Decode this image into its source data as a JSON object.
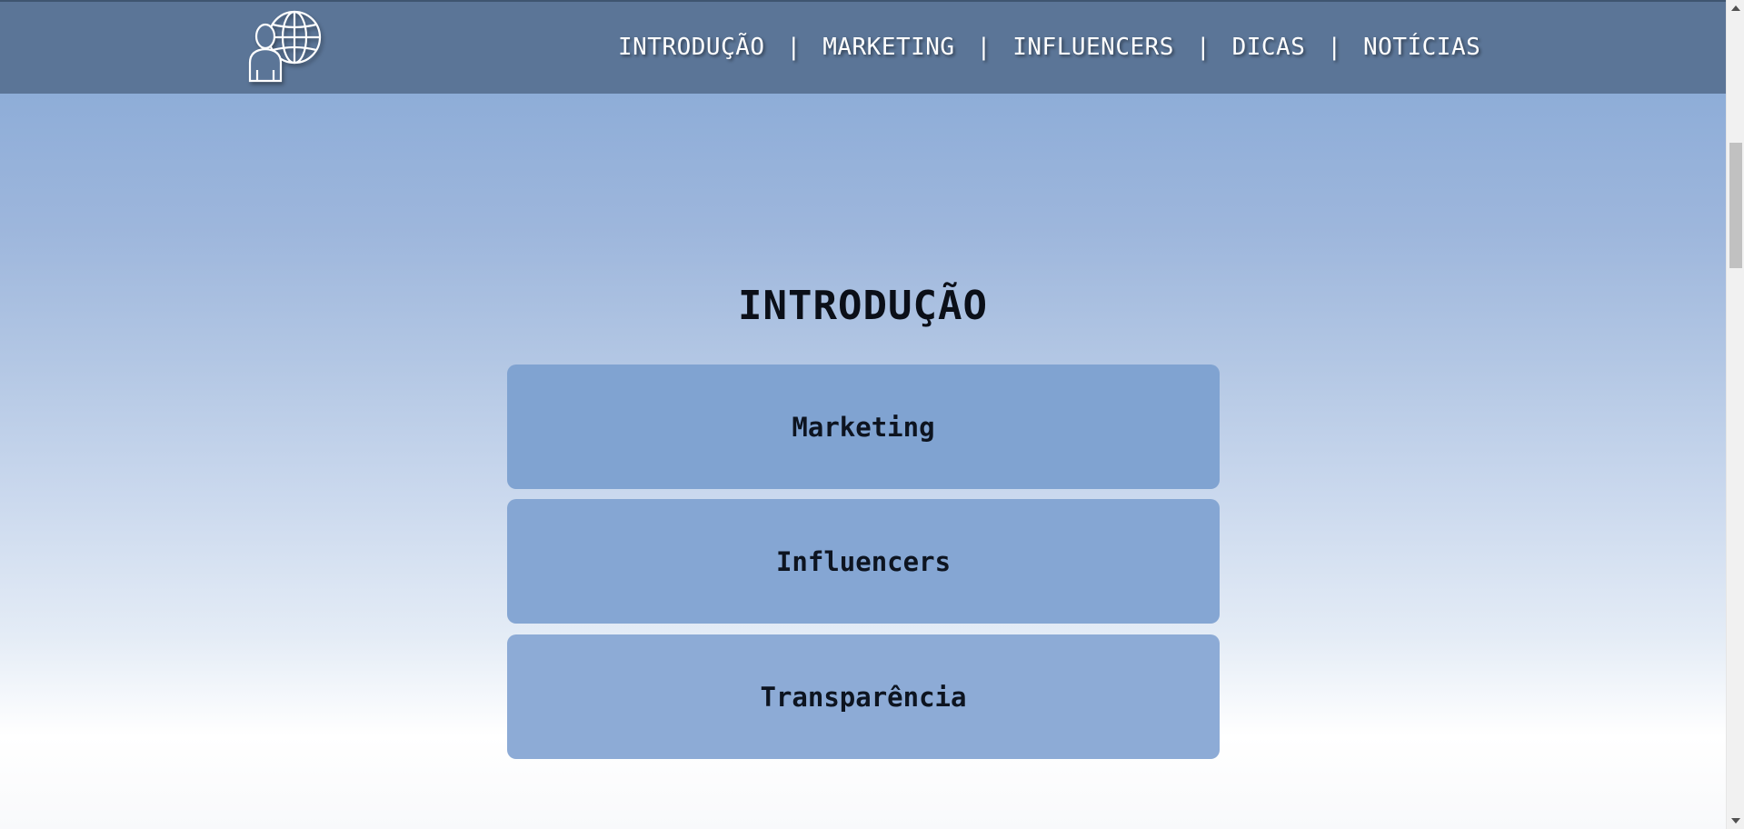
{
  "header": {
    "logo_icon": "person-globe-icon",
    "nav": [
      {
        "label": "INTRODUÇÃO"
      },
      {
        "label": "MARKETING"
      },
      {
        "label": "INFLUENCERS"
      },
      {
        "label": "DICAS"
      },
      {
        "label": "NOTÍCIAS"
      }
    ],
    "separator": "|"
  },
  "main": {
    "title": "INTRODUÇÃO",
    "cards": [
      {
        "label": "Marketing"
      },
      {
        "label": "Influencers"
      },
      {
        "label": "Transparência"
      }
    ]
  },
  "colors": {
    "header_bg": "#5b7597",
    "gradient_top": "#8aa9d6",
    "gradient_bottom": "#ffffff",
    "card_bg": "#80a3d1",
    "title_text": "#0b0f18"
  }
}
